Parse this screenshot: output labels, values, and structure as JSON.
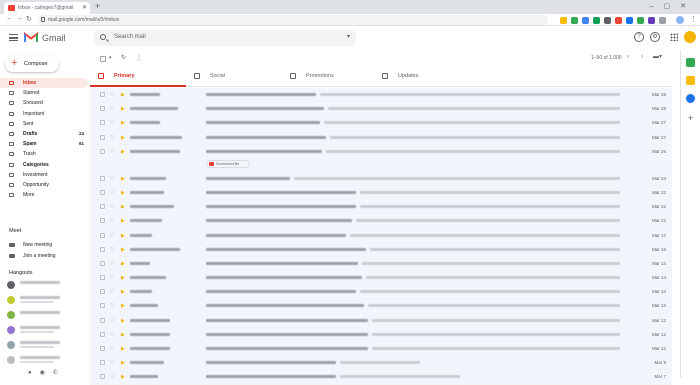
{
  "browser": {
    "tab_title": "Inbox - calmgeo7@gmail",
    "url": "mail.google.com/mail/u/0/#inbox"
  },
  "header": {
    "brand": "Gmail",
    "search_placeholder": "Search mail"
  },
  "compose": {
    "label": "Compose"
  },
  "sidebar": {
    "items": [
      {
        "label": "Inbox",
        "count": ""
      },
      {
        "label": "Starred",
        "count": ""
      },
      {
        "label": "Snoozed",
        "count": ""
      },
      {
        "label": "Important",
        "count": ""
      },
      {
        "label": "Sent",
        "count": ""
      },
      {
        "label": "Drafts",
        "count": "24"
      },
      {
        "label": "Spam",
        "count": "61"
      },
      {
        "label": "Trash",
        "count": ""
      },
      {
        "label": "Categories",
        "count": ""
      },
      {
        "label": "Investment",
        "count": ""
      },
      {
        "label": "Opportunity",
        "count": ""
      },
      {
        "label": "More",
        "count": ""
      }
    ],
    "meet_title": "Meet",
    "meet_items": [
      "New meeting",
      "Join a meeting"
    ],
    "hangouts_title": "Hangouts"
  },
  "toolbar": {
    "pagination": "1–50 of 1,000"
  },
  "tabs": [
    {
      "label": "Primary"
    },
    {
      "label": "Social"
    },
    {
      "label": "Promotions"
    },
    {
      "label": "Updates"
    }
  ],
  "emails": [
    {
      "date": "Mar 28"
    },
    {
      "date": "Mar 28"
    },
    {
      "date": "Mar 27"
    },
    {
      "date": "Mar 27"
    },
    {
      "date": "Mar 26",
      "attachment": "Screenshot file"
    },
    {
      "date": "Mar 24"
    },
    {
      "date": "Mar 22"
    },
    {
      "date": "Mar 22"
    },
    {
      "date": "Mar 22"
    },
    {
      "date": "Mar 17"
    },
    {
      "date": "Mar 16"
    },
    {
      "date": "Mar 14"
    },
    {
      "date": "Mar 14"
    },
    {
      "date": "Mar 14"
    },
    {
      "date": "Mar 13"
    },
    {
      "date": "Mar 12"
    },
    {
      "date": "Mar 12"
    },
    {
      "date": "Mar 12"
    },
    {
      "date": "Mar 9"
    },
    {
      "date": "Mar 7"
    }
  ],
  "colors": {
    "accent": "#d93025",
    "unread_bg": "#ffffff",
    "read_bg": "#f2f6fc"
  }
}
